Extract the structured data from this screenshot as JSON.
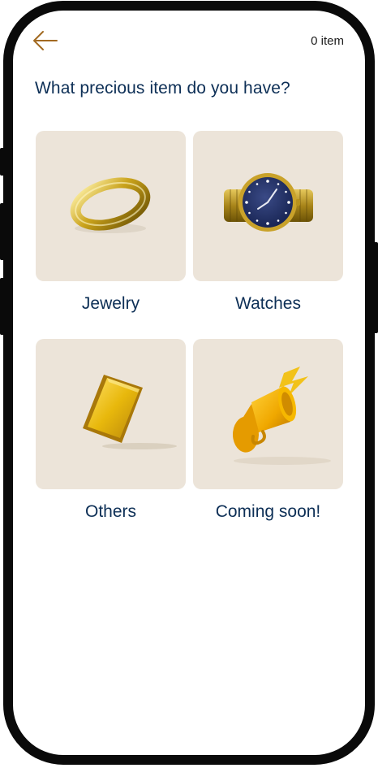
{
  "header": {
    "item_count": "0 item",
    "back_icon": "arrow-left-icon"
  },
  "page": {
    "title": "What precious item do you have?"
  },
  "categories": [
    {
      "label": "Jewelry",
      "icon": "gold-ring-image"
    },
    {
      "label": "Watches",
      "icon": "wristwatch-image"
    },
    {
      "label": "Others",
      "icon": "gold-bar-image"
    },
    {
      "label": "Coming soon!",
      "icon": "megaphone-image"
    }
  ],
  "colors": {
    "accent": "#a26a22",
    "title": "#0d2f56",
    "tile": "#ece4d9"
  }
}
